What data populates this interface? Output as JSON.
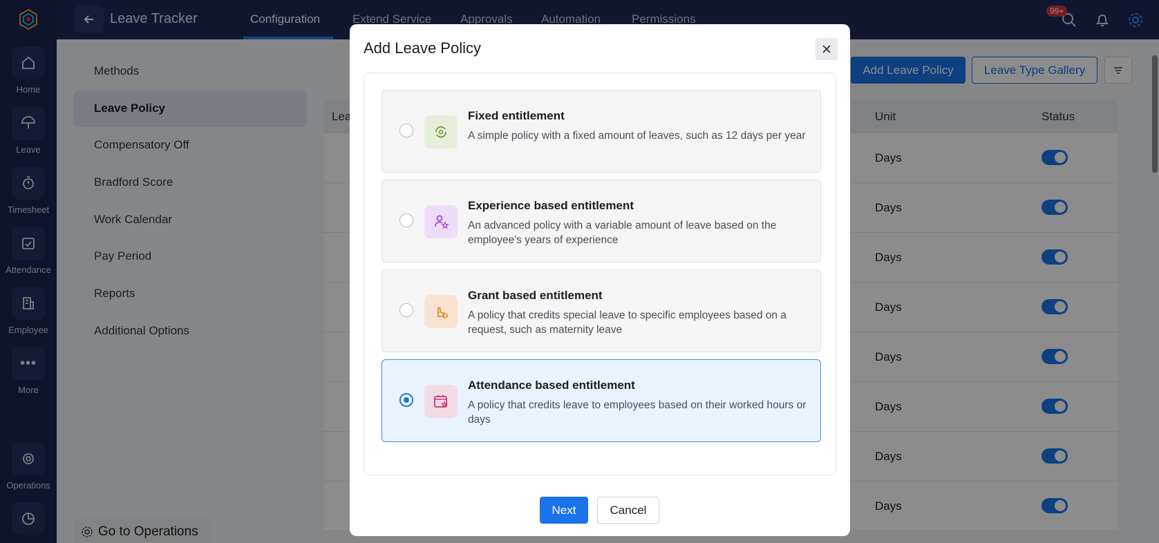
{
  "rail": {
    "items": [
      {
        "label": "Home",
        "icon": "home-icon"
      },
      {
        "label": "Leave",
        "icon": "umbrella-icon"
      },
      {
        "label": "Timesheet",
        "icon": "stopwatch-icon"
      },
      {
        "label": "Attendance",
        "icon": "calendar-check-icon"
      },
      {
        "label": "Employee",
        "icon": "building-icon"
      },
      {
        "label": "More",
        "icon": "more-icon"
      },
      {
        "label": "Operations",
        "icon": "operations-icon"
      }
    ]
  },
  "topbar": {
    "title": "Leave Tracker",
    "tabs": [
      "Configuration",
      "Extend Service",
      "Approvals",
      "Automation",
      "Permissions"
    ],
    "active_tab": "Configuration",
    "notification_count": "99+"
  },
  "subnav": {
    "items": [
      "Methods",
      "Leave Policy",
      "Compensatory Off",
      "Bradford Score",
      "Work Calendar",
      "Pay Period",
      "Reports",
      "Additional Options"
    ],
    "active": "Leave Policy",
    "goto_operations": "Go to Operations"
  },
  "page": {
    "add_policy_label": "Add Leave Policy",
    "gallery_label": "Leave Type Gallery",
    "columns": {
      "leave_type": "Lea",
      "unit": "Unit",
      "status": "Status"
    },
    "rows": [
      {
        "unit": "Days",
        "status": true
      },
      {
        "unit": "Days",
        "status": true
      },
      {
        "unit": "Days",
        "status": true
      },
      {
        "unit": "Days",
        "status": true
      },
      {
        "unit": "Days",
        "status": true
      },
      {
        "unit": "Days",
        "status": true
      },
      {
        "unit": "Days",
        "status": true
      },
      {
        "unit": "Days",
        "status": true
      }
    ]
  },
  "modal": {
    "title": "Add Leave Policy",
    "options": [
      {
        "title": "Fixed entitlement",
        "description": "A simple policy with a fixed amount of leaves, such as 12 days per year",
        "selected": false,
        "icon": "refresh-cycle-icon",
        "color": "#e6eedb"
      },
      {
        "title": "Experience based entitlement",
        "description": "An advanced policy with a variable amount of leave based on the employee's years of experience",
        "selected": false,
        "icon": "user-star-icon",
        "color": "#eedcf6"
      },
      {
        "title": "Grant based entitlement",
        "description": "A policy that credits special leave to specific employees based on a request, such as maternity leave",
        "selected": false,
        "icon": "hand-coin-icon",
        "color": "#f8e3d1"
      },
      {
        "title": "Attendance based entitlement",
        "description": "A policy that credits leave to employees based on their worked hours or days",
        "selected": true,
        "icon": "calendar-star-icon",
        "color": "#f3dbe6"
      }
    ],
    "next_label": "Next",
    "cancel_label": "Cancel"
  }
}
